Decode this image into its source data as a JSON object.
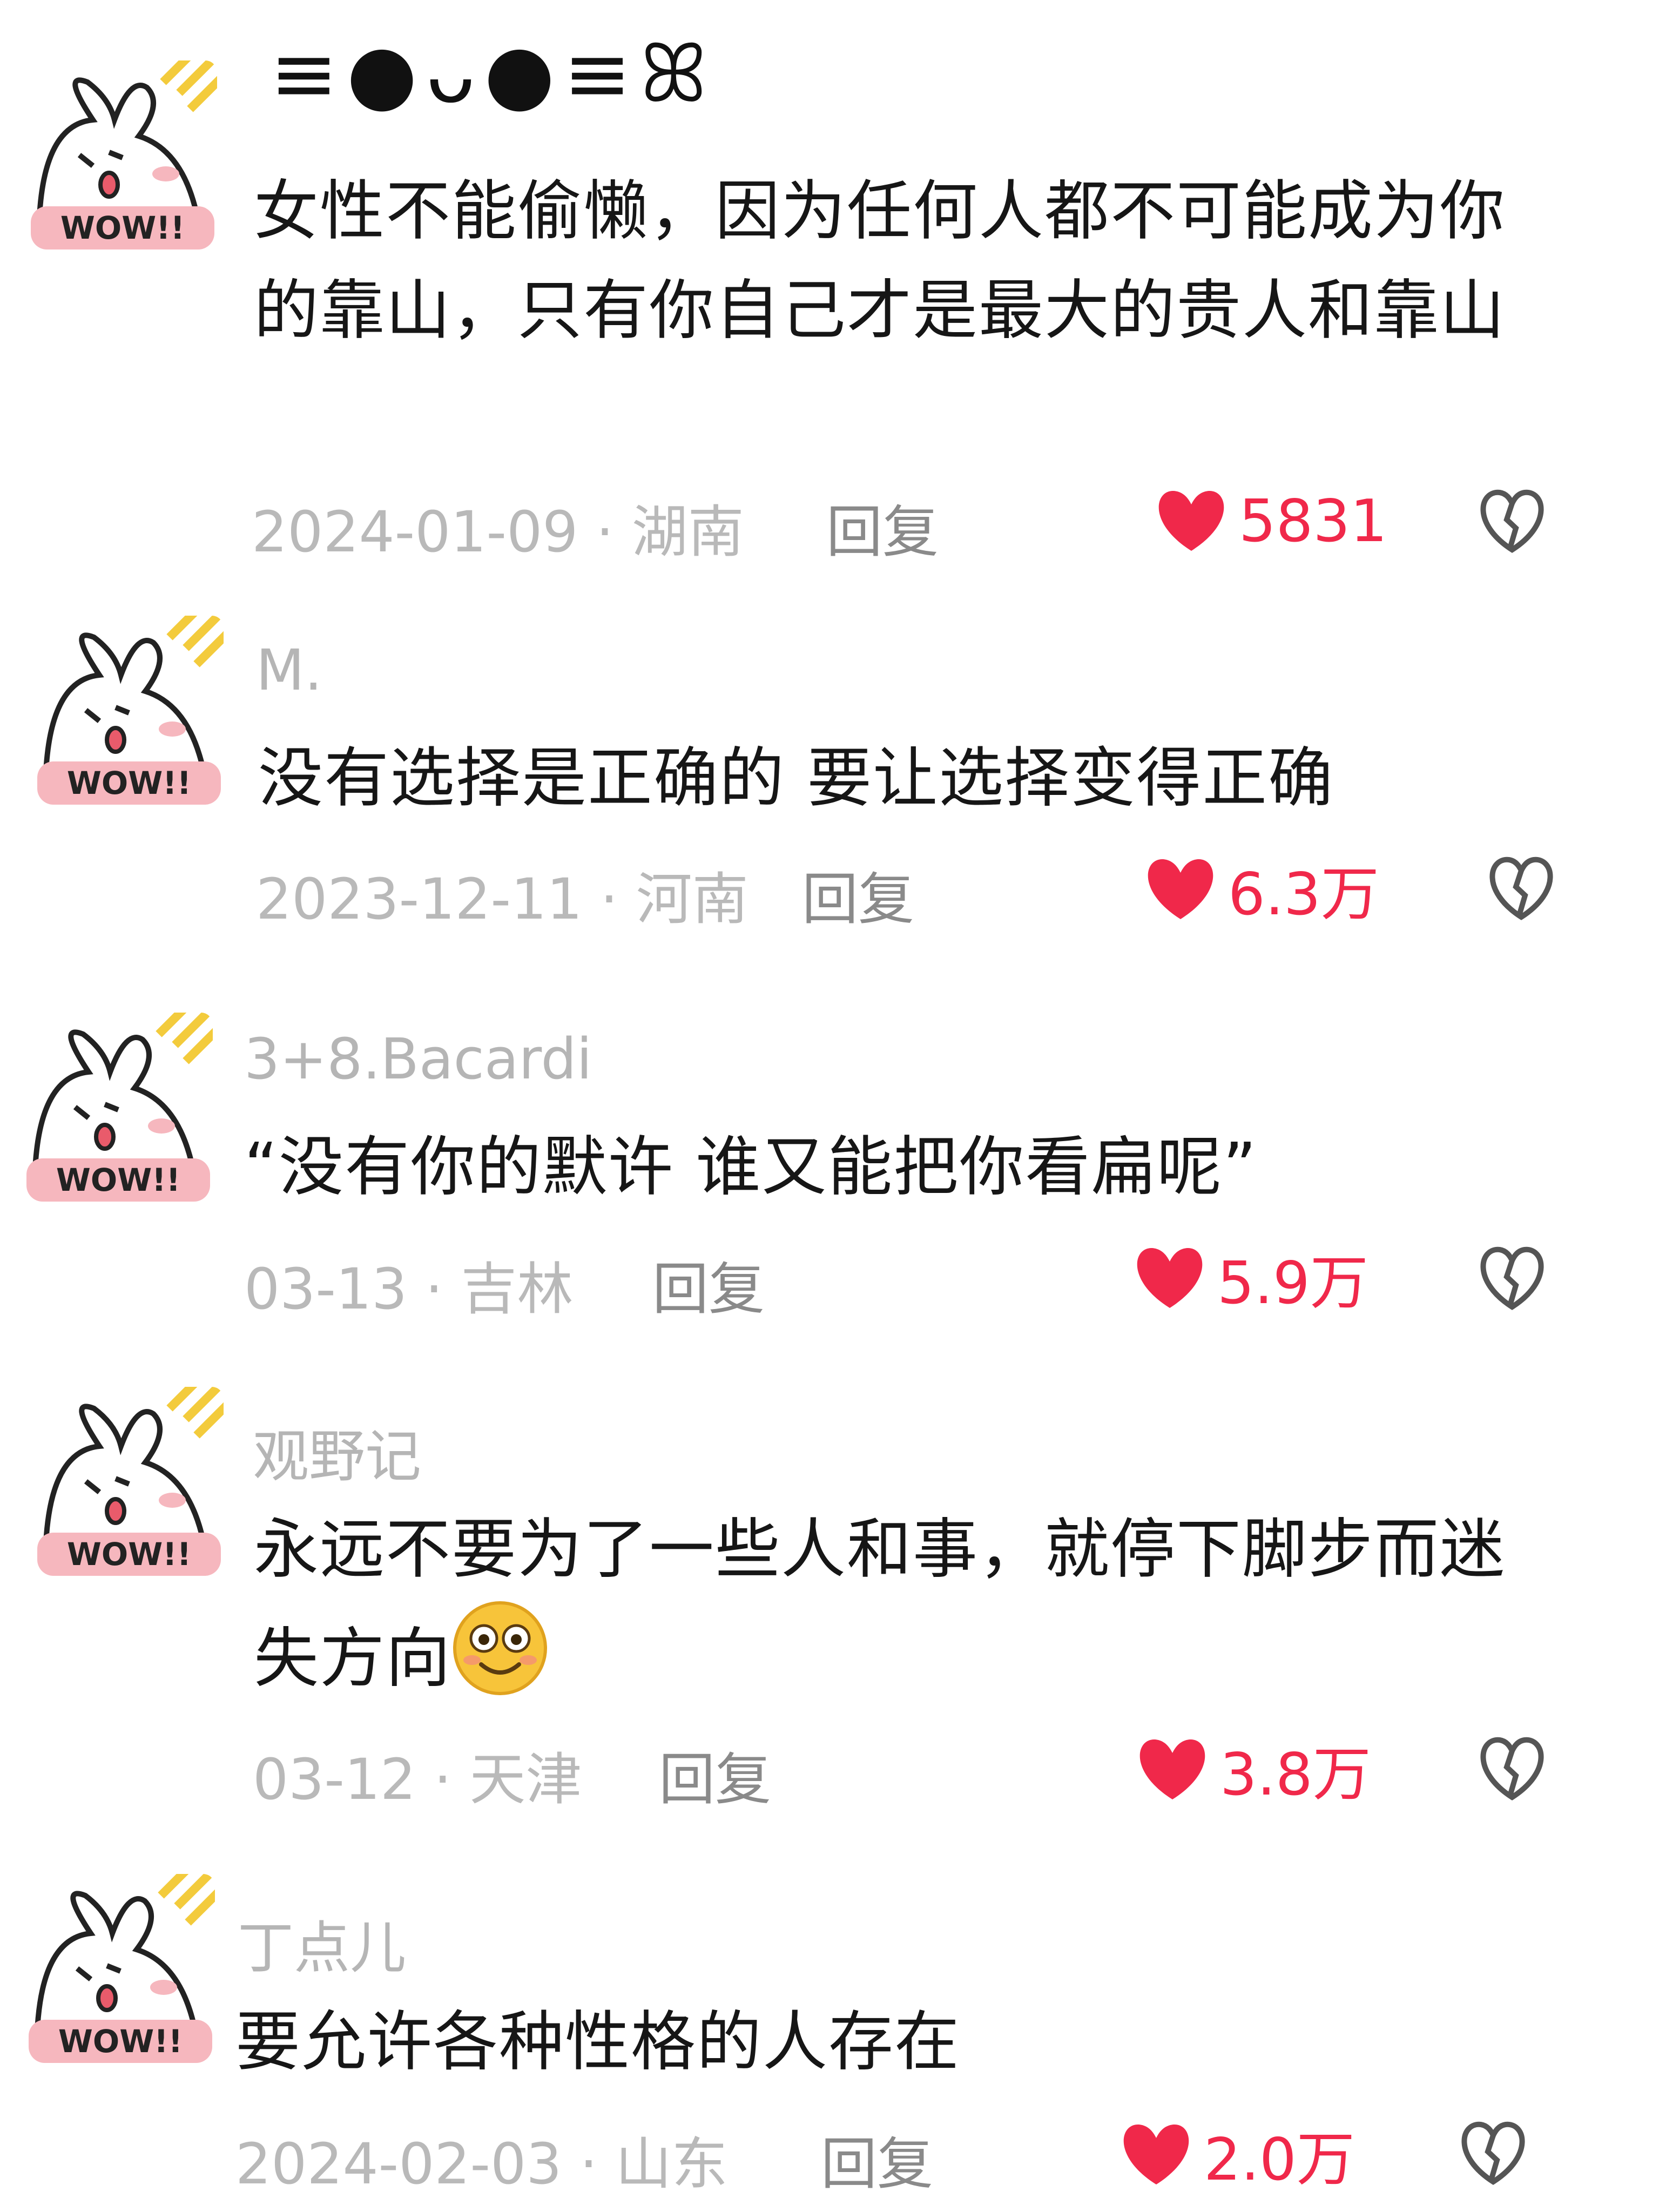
{
  "comments": [
    {
      "username": "≡●ᴗ●≡ꕤ",
      "text": "女性不能偷懒，因为任何人都不可能成为你的靠山，只有你自己才是最大的贵人和靠山",
      "date_location": "2024-01-09 · 湖南",
      "reply": "回复",
      "likes": "5831"
    },
    {
      "username": "M.",
      "text": "没有选择是正确的 要让选择变得正确",
      "date_location": "2023-12-11 · 河南",
      "reply": "回复",
      "likes": "6.3万"
    },
    {
      "username": "3+8.Bacardi",
      "text": "“没有你的默许 谁又能把你看扁呢”",
      "date_location": "03-13 · 吉林",
      "reply": "回复",
      "likes": "5.9万"
    },
    {
      "username": "观野记",
      "text": "永远不要为了一些人和事，就停下脚步而迷失方向",
      "date_location": "03-12 · 天津",
      "reply": "回复",
      "likes": "3.8万"
    },
    {
      "username": "丁点儿",
      "text": "要允许各种性格的人存在",
      "date_location": "2024-02-03 · 山东",
      "reply": "回复",
      "likes": "2.0万"
    }
  ],
  "avatar_badge": "WOW!!",
  "colors": {
    "like": "#f0284a",
    "muted": "#b9b9b9",
    "reply": "#8a8a8a",
    "text": "#161616"
  },
  "icons": [
    "heart-filled-icon",
    "heart-broken-icon",
    "smiley-emoji-icon"
  ]
}
